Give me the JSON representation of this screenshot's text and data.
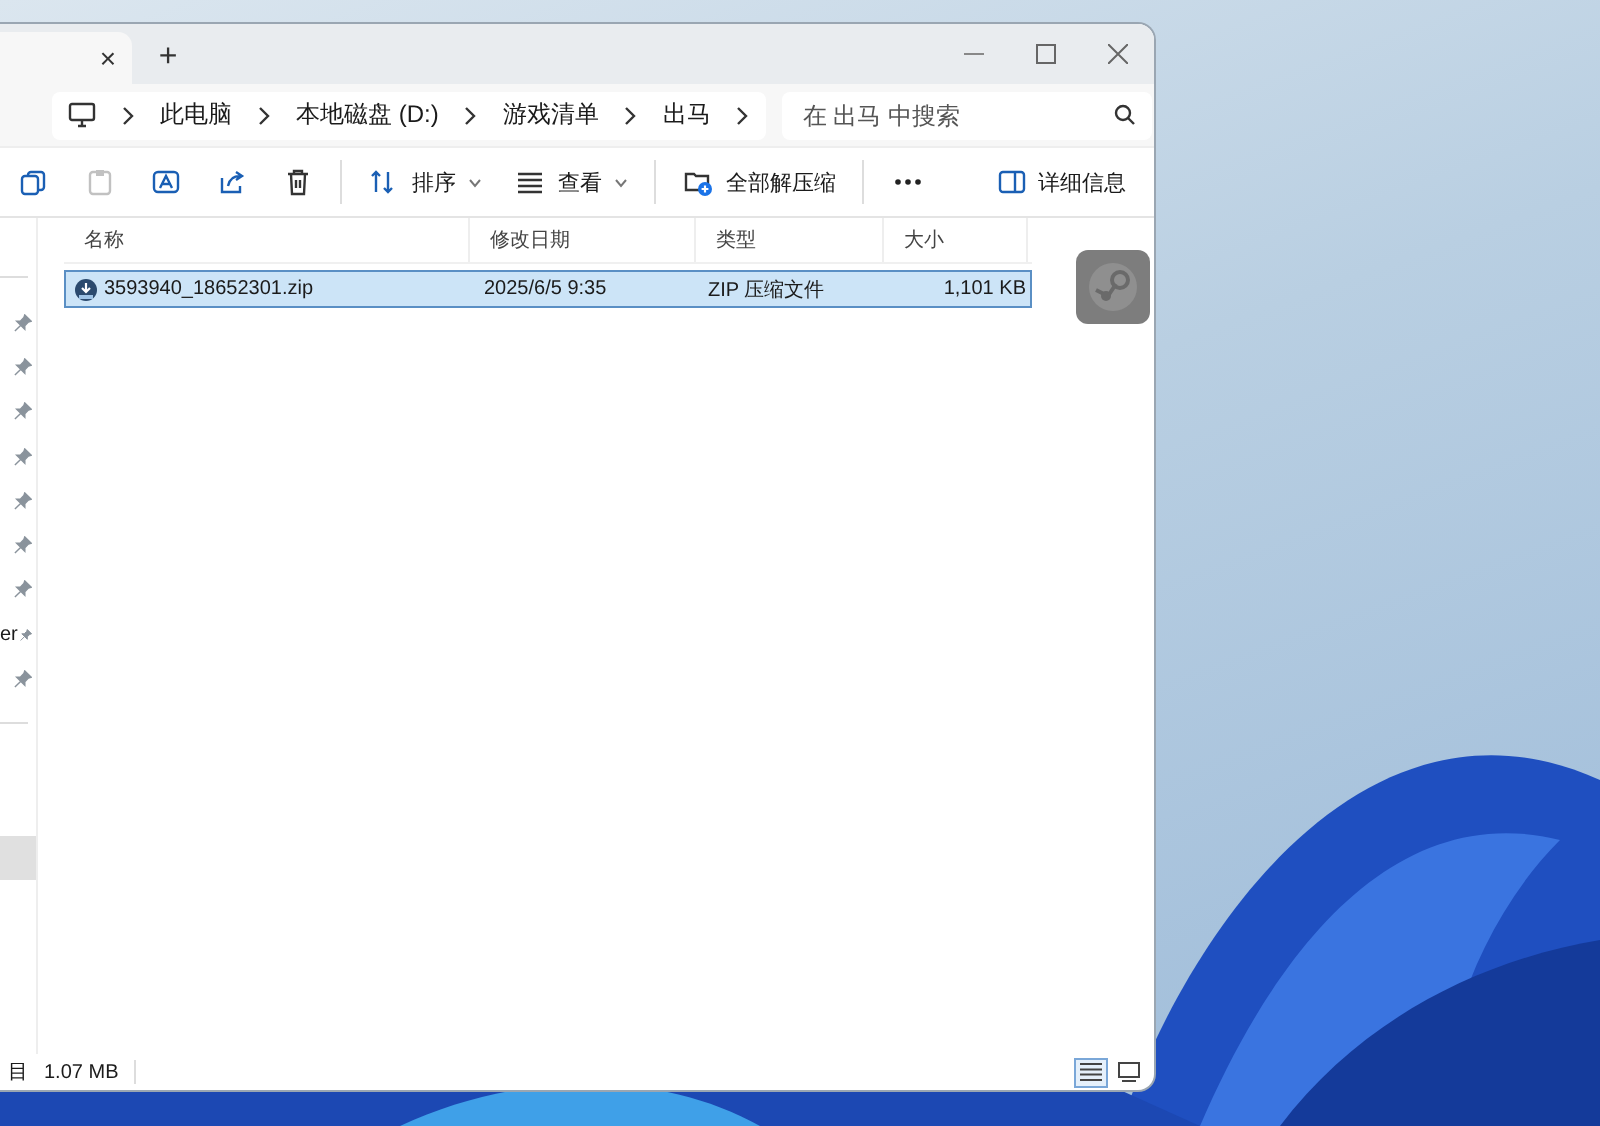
{
  "tabs": [
    {
      "close": "×",
      "selected": true
    }
  ],
  "new_tab": "+",
  "breadcrumb": [
    "此电脑",
    "本地磁盘 (D:)",
    "游戏清单",
    "出马"
  ],
  "search": {
    "placeholder": "在 出马 中搜索"
  },
  "toolbar": [
    {
      "kind": "copy",
      "disabled": false
    },
    {
      "kind": "paste",
      "disabled": true
    },
    {
      "kind": "rename",
      "disabled": false
    },
    {
      "kind": "share",
      "disabled": false
    },
    {
      "kind": "delete",
      "disabled": false
    },
    {
      "kind": "sort",
      "label": "排序",
      "disabled": false
    },
    {
      "kind": "view",
      "label": "查看",
      "disabled": false
    },
    {
      "kind": "extract",
      "label": "全部解压缩",
      "disabled": false
    },
    {
      "kind": "more",
      "disabled": false
    }
  ],
  "details_button": "详细信息",
  "sidebar": {
    "pinned_items": [
      {
        "pinned": true
      },
      {
        "pinned": true
      },
      {
        "pinned": true
      },
      {
        "pinned": true
      },
      {
        "pinned": true
      },
      {
        "pinned": true
      },
      {
        "pinned": true
      },
      {
        "label": "er",
        "pinned": true
      },
      {
        "pinned": true
      }
    ],
    "lower_items": [
      {
        "selected": true
      }
    ]
  },
  "table": {
    "columns": [
      "名称",
      "修改日期",
      "类型",
      "大小"
    ],
    "rows": [
      {
        "name": "3593940_18652301.zip",
        "modified": "2025/6/5 9:35",
        "type": "ZIP 压缩文件",
        "size": "1,101 KB",
        "selected": true
      }
    ]
  },
  "status_bar": {
    "count_fragment": "目",
    "size": "1.07 MB",
    "view_modes": [
      {
        "kind": "details",
        "selected": true
      },
      {
        "kind": "tiles",
        "selected": false
      }
    ]
  }
}
